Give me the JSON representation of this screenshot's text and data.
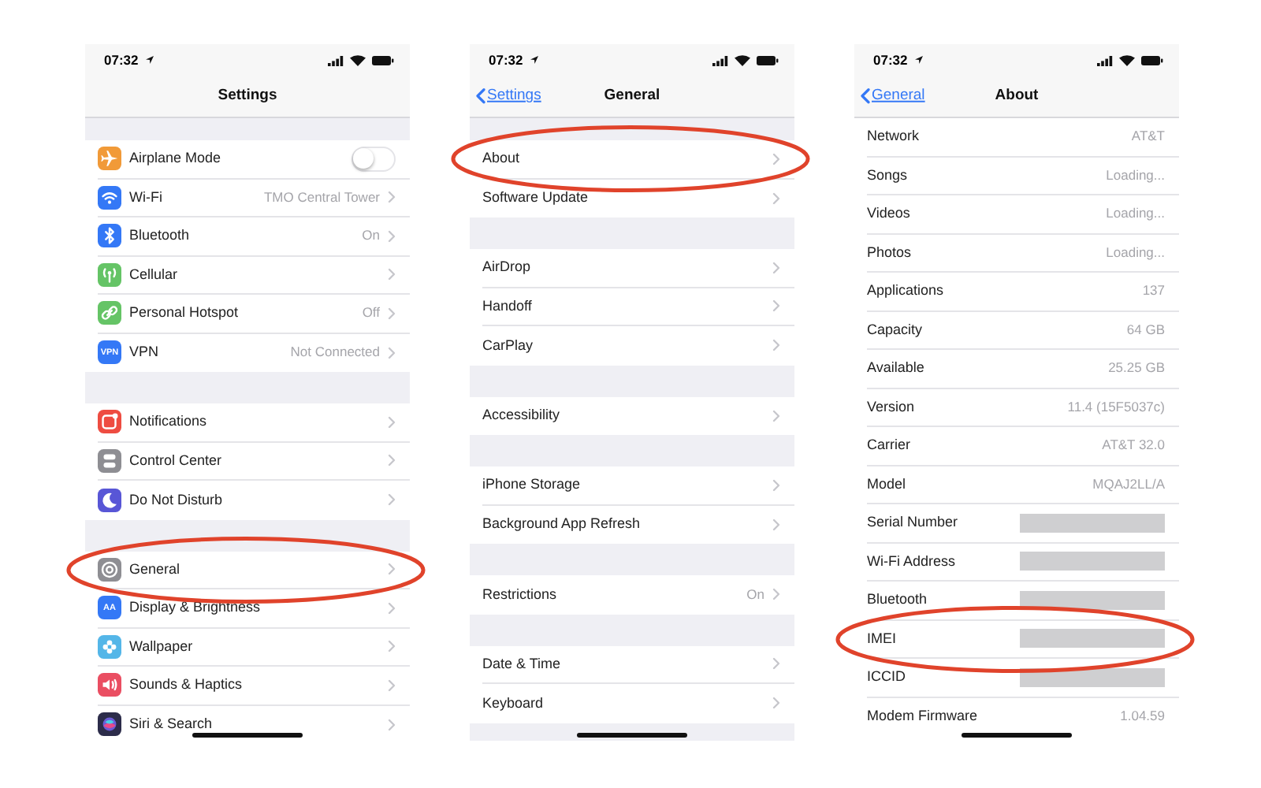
{
  "screens": [
    {
      "status_time": "07:32",
      "title": "Settings",
      "grouped": true,
      "sections": [
        {
          "rows": [
            {
              "label": "Airplane Mode",
              "kind": "toggle",
              "on": false,
              "color": "#f19a38",
              "highlighted": false
            },
            {
              "label": "Wi-Fi",
              "value": "TMO Central Tower",
              "kind": "link",
              "color": "#3478f6",
              "highlighted": false
            },
            {
              "label": "Bluetooth",
              "value": "On",
              "kind": "link",
              "color": "#3478f6",
              "highlighted": false
            },
            {
              "label": "Cellular",
              "kind": "link",
              "color": "#65c466",
              "highlighted": false
            },
            {
              "label": "Personal Hotspot",
              "value": "Off",
              "kind": "link",
              "color": "#65c466",
              "highlighted": false
            },
            {
              "label": "VPN",
              "kind": "link",
              "value": "Not Connected",
              "color": "#3478f6",
              "glyph_text": "VPN",
              "highlighted": false
            }
          ]
        },
        {
          "rows": [
            {
              "label": "Notifications",
              "kind": "link",
              "color": "#ee4c41",
              "highlighted": false
            },
            {
              "label": "Control Center",
              "kind": "link",
              "color": "#8e8e93",
              "highlighted": false
            },
            {
              "label": "Do Not Disturb",
              "kind": "link",
              "color": "#5856d6",
              "highlighted": false
            }
          ]
        },
        {
          "rows": [
            {
              "label": "General",
              "kind": "link",
              "color": "#8e8e93",
              "highlighted": true
            },
            {
              "label": "Display & Brightness",
              "kind": "link",
              "color": "#3478f6",
              "glyph_text": "AA",
              "highlighted": false
            },
            {
              "label": "Wallpaper",
              "kind": "link",
              "color": "#54b6e8",
              "highlighted": false
            },
            {
              "label": "Sounds & Haptics",
              "kind": "link",
              "color": "#ea4e62",
              "highlighted": false
            },
            {
              "label": "Siri & Search",
              "kind": "link",
              "color": "#2c2c4a",
              "highlighted": false
            }
          ]
        }
      ]
    },
    {
      "status_time": "07:32",
      "back": "Settings",
      "title": "General",
      "grouped": true,
      "sections": [
        {
          "rows": [
            {
              "label": "About",
              "kind": "link",
              "highlighted": true
            },
            {
              "label": "Software Update",
              "kind": "link",
              "highlighted": false
            }
          ]
        },
        {
          "rows": [
            {
              "label": "AirDrop",
              "kind": "link",
              "highlighted": false
            },
            {
              "label": "Handoff",
              "kind": "link",
              "highlighted": false
            },
            {
              "label": "CarPlay",
              "kind": "link",
              "highlighted": false
            }
          ]
        },
        {
          "rows": [
            {
              "label": "Accessibility",
              "kind": "link",
              "highlighted": false
            }
          ]
        },
        {
          "rows": [
            {
              "label": "iPhone Storage",
              "kind": "link",
              "highlighted": false
            },
            {
              "label": "Background App Refresh",
              "kind": "link",
              "highlighted": false
            }
          ]
        },
        {
          "rows": [
            {
              "label": "Restrictions",
              "value": "On",
              "kind": "link",
              "highlighted": false
            }
          ]
        },
        {
          "rows": [
            {
              "label": "Date & Time",
              "kind": "link",
              "highlighted": false
            },
            {
              "label": "Keyboard",
              "kind": "link",
              "highlighted": false
            }
          ]
        }
      ]
    },
    {
      "status_time": "07:32",
      "back": "General",
      "title": "About",
      "grouped": false,
      "sections": [
        {
          "rows": [
            {
              "label": "Network",
              "value": "AT&T",
              "kind": "plain",
              "highlighted": false
            },
            {
              "label": "Songs",
              "value": "Loading...",
              "kind": "plain",
              "highlighted": false
            },
            {
              "label": "Videos",
              "value": "Loading...",
              "kind": "plain",
              "highlighted": false
            },
            {
              "label": "Photos",
              "value": "Loading...",
              "kind": "plain",
              "highlighted": false
            },
            {
              "label": "Applications",
              "value": "137",
              "kind": "plain",
              "highlighted": false
            },
            {
              "label": "Capacity",
              "value": "64 GB",
              "kind": "plain",
              "highlighted": false
            },
            {
              "label": "Available",
              "value": "25.25 GB",
              "kind": "plain",
              "highlighted": false
            },
            {
              "label": "Version",
              "value": "11.4 (15F5037c)",
              "kind": "plain",
              "highlighted": false
            },
            {
              "label": "Carrier",
              "value": "AT&T 32.0",
              "kind": "plain",
              "highlighted": false
            },
            {
              "label": "Model",
              "value": "MQAJ2LL/A",
              "kind": "plain",
              "highlighted": false
            },
            {
              "label": "Serial Number",
              "kind": "redacted",
              "highlighted": false
            },
            {
              "label": "Wi-Fi Address",
              "kind": "redacted",
              "highlighted": false
            },
            {
              "label": "Bluetooth",
              "kind": "redacted",
              "highlighted": false
            },
            {
              "label": "IMEI",
              "kind": "redacted",
              "highlighted": true
            },
            {
              "label": "ICCID",
              "kind": "redacted",
              "highlighted": false
            },
            {
              "label": "Modem Firmware",
              "value": "1.04.59",
              "kind": "plain",
              "highlighted": false
            }
          ]
        }
      ]
    }
  ]
}
